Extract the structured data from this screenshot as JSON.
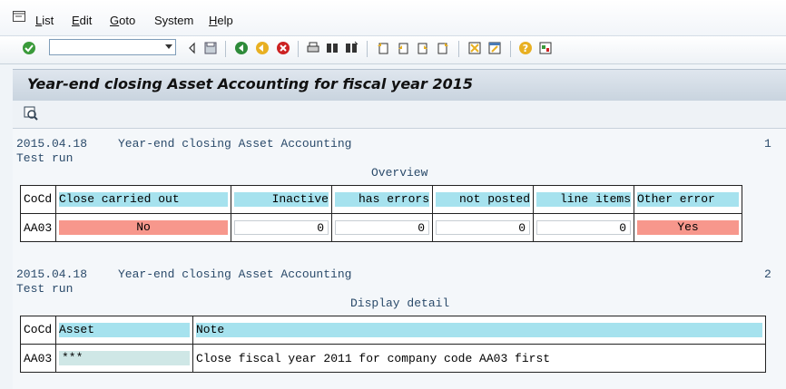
{
  "menu": {
    "items": [
      {
        "label": "List",
        "key": "L",
        "rest": "ist"
      },
      {
        "label": "Edit",
        "key": "E",
        "rest": "dit"
      },
      {
        "label": "Goto",
        "key": "G",
        "rest": "oto"
      },
      {
        "label": "System",
        "key": "",
        "rest": "System"
      },
      {
        "label": "Help",
        "key": "H",
        "rest": "elp"
      }
    ]
  },
  "command_field": {
    "value": ""
  },
  "page": {
    "title": "Year-end closing Asset Accounting for fiscal year 2015"
  },
  "section1": {
    "date": "2015.04.18",
    "heading": "Year-end closing Asset Accounting",
    "page_no": "1",
    "mode": "Test run",
    "subtitle": "Overview",
    "headers": [
      "CoCd",
      "Close carried out",
      "Inactive",
      "has errors",
      "not posted",
      "line items",
      "Other error"
    ],
    "row": {
      "cocd": "AA03",
      "close": "No",
      "inactive": "0",
      "errors": "0",
      "not_posted": "0",
      "line_items": "0",
      "other": "Yes"
    }
  },
  "section2": {
    "date": "2015.04.18",
    "heading": "Year-end closing Asset Accounting",
    "page_no": "2",
    "mode": "Test run",
    "subtitle": "Display detail",
    "headers": [
      "CoCd",
      "Asset",
      "Note"
    ],
    "row": {
      "cocd": "AA03",
      "asset": "***",
      "note": "Close fiscal year 2011 for company code AA03 first"
    }
  },
  "colors": {
    "header_cell": "#a6e2ee",
    "error_cell": "#f7978c",
    "asset_cell": "#cfe7e6"
  }
}
